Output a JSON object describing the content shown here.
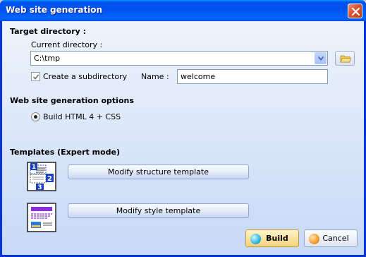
{
  "window": {
    "title": "Web site generation"
  },
  "target": {
    "heading": "Target directory :",
    "current_label": "Current directory :",
    "current_value": "C:\\tmp",
    "subdir_label": "Create a subdirectory",
    "subdir_checked": true,
    "name_label": "Name :",
    "name_value": "welcome"
  },
  "options": {
    "heading": "Web site generation options",
    "radio_label": "Build HTML 4 + CSS",
    "radio_selected": true
  },
  "templates": {
    "heading": "Templates (Expert mode)",
    "structure_button": "Modify structure template",
    "style_button": "Modify style template",
    "structure_icon_numbers": [
      "1",
      "2",
      "3"
    ]
  },
  "actions": {
    "build_label": "Build",
    "cancel_label": "Cancel"
  },
  "icons": {
    "close": "close-icon",
    "dropdown": "chevron-down-icon",
    "browse": "folder-icon",
    "structure": "structure-template-icon",
    "style": "style-template-icon",
    "build": "build-icon",
    "cancel": "cancel-icon"
  },
  "colors": {
    "titlebar": "#0053ee",
    "close": "#d8532f",
    "client": "#c6d9f6",
    "accent_number": "#1a3fc0",
    "style_text": "#8a2be2"
  }
}
